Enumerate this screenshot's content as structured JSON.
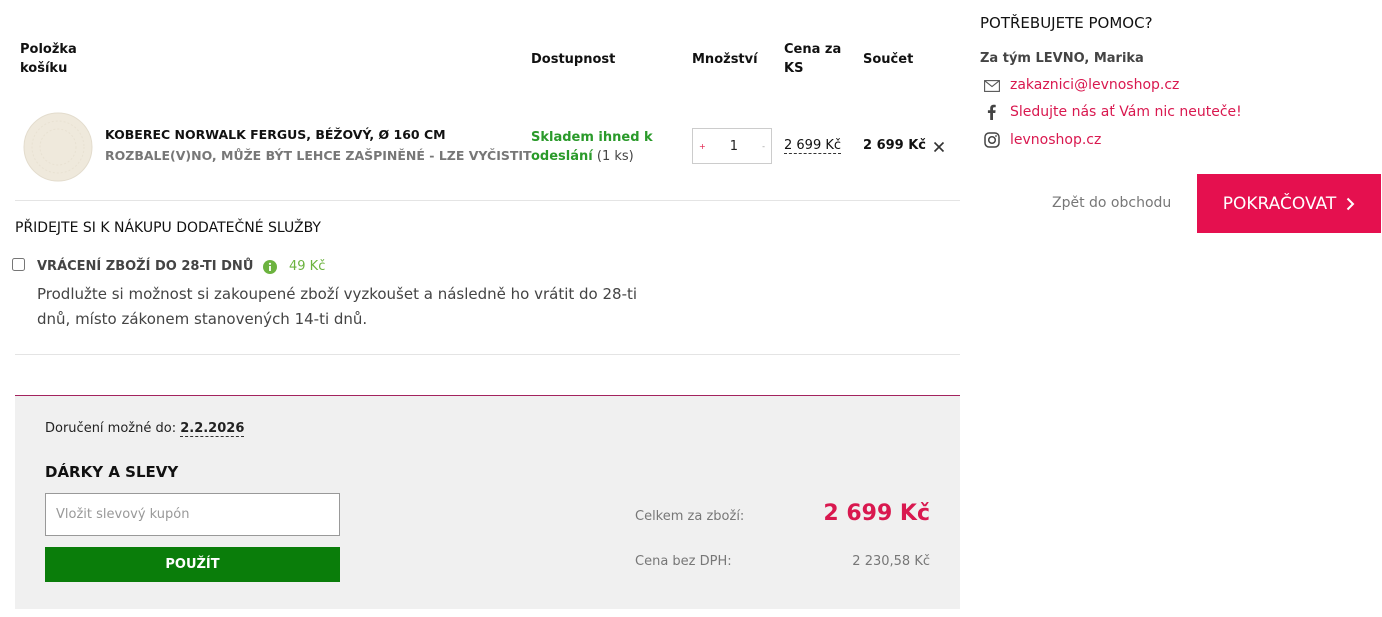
{
  "cart": {
    "headers": {
      "item": [
        "Položka",
        "košíku"
      ],
      "availability": "Dostupnost",
      "quantity": "Množství",
      "unit_price": [
        "Cena za",
        "KS"
      ],
      "total": "Součet"
    },
    "item": {
      "name": "KOBEREC NORWALK FERGUS, BÉŽOVÝ, Ø 160 CM",
      "note": "ROZBALE(V)NO, MŮŽE BÝT LEHCE ZAŠPINĚNÉ - LZE VYČISTIT",
      "availability_line1": "Skladem ihned k",
      "availability_line2": "odeslání",
      "availability_count": "(1 ks)",
      "quantity": "1",
      "unit_price": "2 699 Kč",
      "total": "2 699 Kč"
    }
  },
  "services": {
    "title": "PŘIDEJTE SI K NÁKUPU DODATEČNÉ SLUŽBY",
    "return": {
      "label": "VRÁCENÍ ZBOŽÍ DO 28-TI DNŮ",
      "price": "49 Kč",
      "desc_line1": "Prodlužte si možnost si zakoupené zboží vyzkoušet a následně ho vrátit do 28-ti",
      "desc_line2": "dnů, místo zákonem stanovených 14-ti dnů."
    }
  },
  "summary": {
    "delivery_label": "Doručení možné do:",
    "delivery_date": "2.2.2026",
    "gifts_title": "DÁRKY A SLEVY",
    "coupon_placeholder": "Vložit slevový kupón",
    "apply_label": "POUŽÍT",
    "total_label": "Celkem za zboží:",
    "total_value": "2 699 Kč",
    "net_label": "Cena bez DPH:",
    "net_value": "2 230,58 Kč"
  },
  "help": {
    "title": "POTŘEBUJETE POMOC?",
    "team": "Za tým LEVNO, Marika",
    "email": "zakaznici@levnoshop.cz",
    "facebook": "Sledujte nás ať Vám nic neuteče!",
    "instagram": "levnoshop.cz",
    "back_label": "Zpět do obchodu",
    "continue_label": "POKRAČOVAT"
  },
  "colors": {
    "accent": "#e5104f",
    "stock_green": "#2a9a2a",
    "apply_green": "#0a7d0a"
  },
  "icons": [
    "close-icon",
    "info-icon",
    "mail-icon",
    "facebook-icon",
    "instagram-icon",
    "chevron-right-icon"
  ]
}
